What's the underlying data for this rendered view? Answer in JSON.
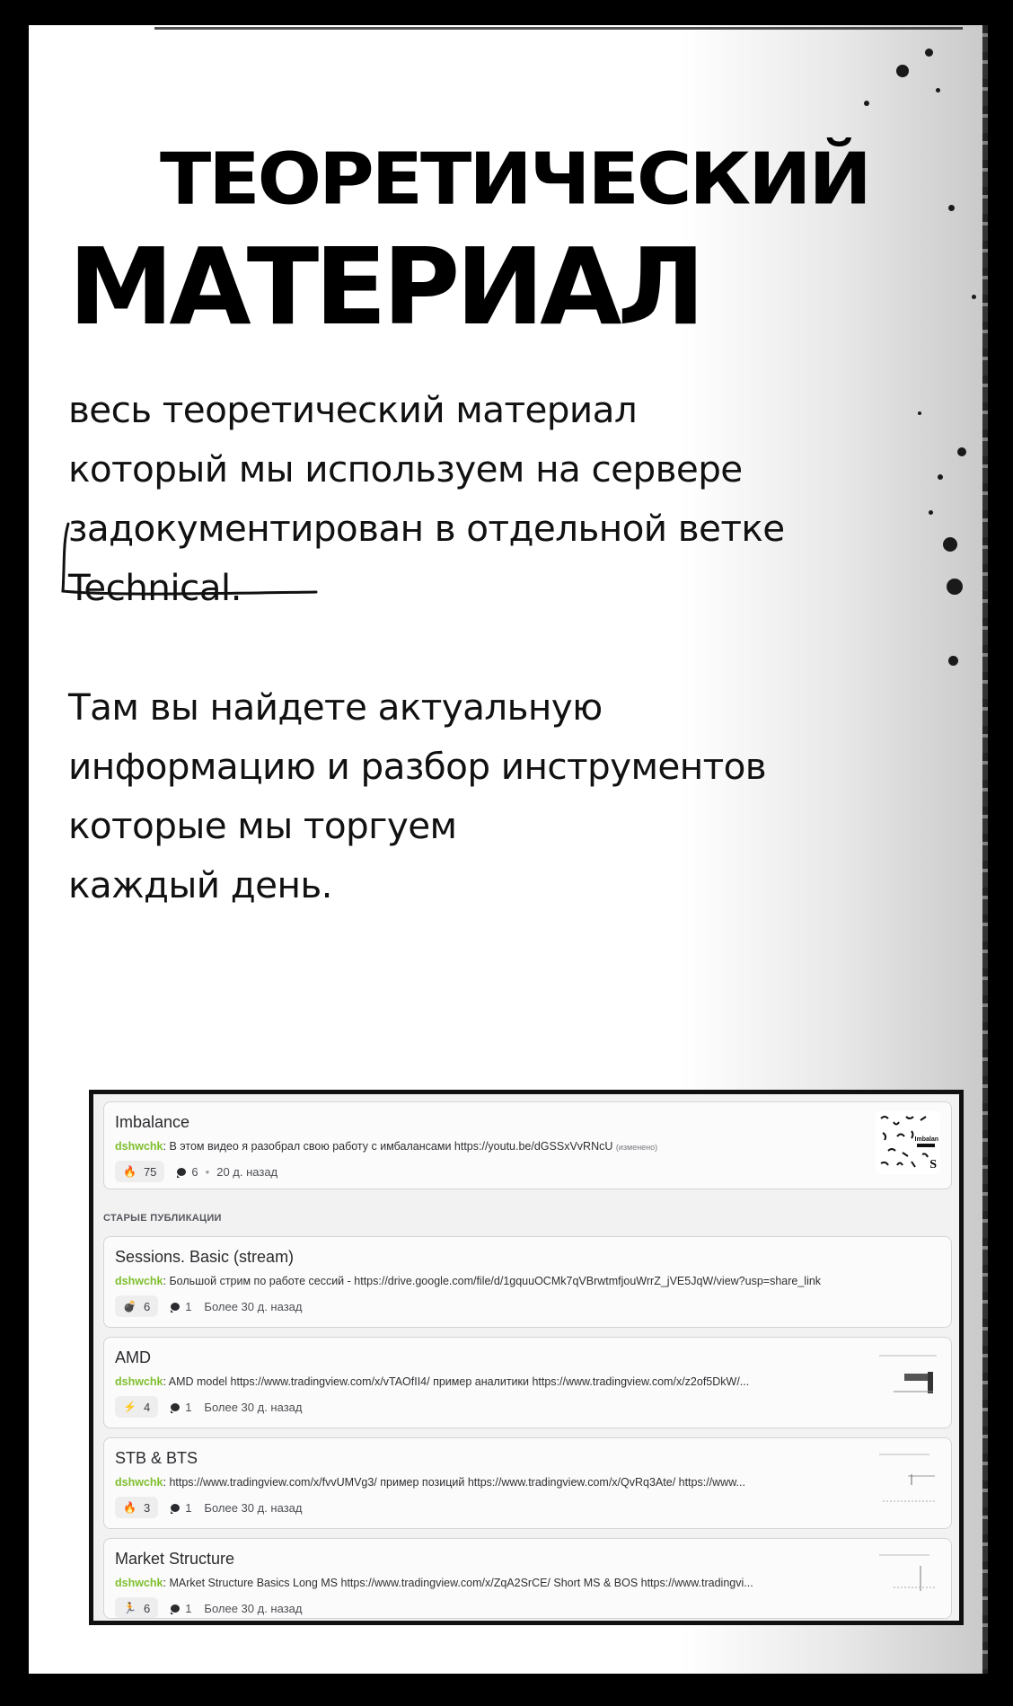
{
  "heading": {
    "line1": "ТЕОРЕТИЧЕСКИЙ",
    "line2": "МАТЕРИАЛ"
  },
  "paragraph1": [
    "весь теоретический материал",
    "который мы используем на сервере",
    "задокументирован в отдельной ветке",
    "Technical."
  ],
  "paragraph2": [
    "Там вы найдете актуальную",
    "информацию и разбор инструментов",
    "которые мы торгуем",
    "каждый день."
  ],
  "forum": {
    "section_label": "СТАРЫЕ ПУБЛИКАЦИИ",
    "accent_author_color": "#7fbf2e",
    "posts": [
      {
        "title": "Imbalance",
        "author": "dshwchk",
        "text": "В этом видео я разобрал свою работу с имбалансами https://youtu.be/dGSSxVvRNcU",
        "edited": "(изменено)",
        "reaction_icon": "fire-emoji",
        "reaction_glyph": "🔥",
        "reaction_count": "75",
        "comments": "6",
        "time": "20 д. назад",
        "thumb_label": "Imbalan",
        "thumb_letter": "S"
      },
      {
        "title": "Sessions. Basic (stream)",
        "author": "dshwchk",
        "text": "Большой стрим по работе сессий - https://drive.google.com/file/d/1gquuOCMk7qVBrwtmfjouWrrZ_jVE5JqW/view?usp=share_link",
        "reaction_icon": "bomb-emoji",
        "reaction_glyph": "💣",
        "reaction_count": "6",
        "comments": "1",
        "time": "Более 30 д. назад"
      },
      {
        "title": "AMD",
        "author": "dshwchk",
        "text": "AMD model https://www.tradingview.com/x/vTAOfII4/ пример аналитики https://www.tradingview.com/x/z2of5DkW/...",
        "reaction_icon": "lightning-emoji",
        "reaction_glyph": "⚡",
        "reaction_count": "4",
        "comments": "1",
        "time": "Более 30 д. назад"
      },
      {
        "title": "STB & BTS",
        "author": "dshwchk",
        "text": "https://www.tradingview.com/x/fvvUMVg3/ пример позиций https://www.tradingview.com/x/QvRq3Ate/ https://www...",
        "reaction_icon": "fire-emoji",
        "reaction_glyph": "🔥",
        "reaction_count": "3",
        "comments": "1",
        "time": "Более 30 д. назад"
      },
      {
        "title": "Market Structure",
        "author": "dshwchk",
        "text": "MArket Structure Basics Long MS https://www.tradingview.com/x/ZqA2SrCE/ Short MS & BOS https://www.tradingvi...",
        "reaction_icon": "running-person-emoji",
        "reaction_glyph": "🏃",
        "reaction_count": "6",
        "comments": "1",
        "time": "Более 30 д. назад"
      }
    ]
  }
}
